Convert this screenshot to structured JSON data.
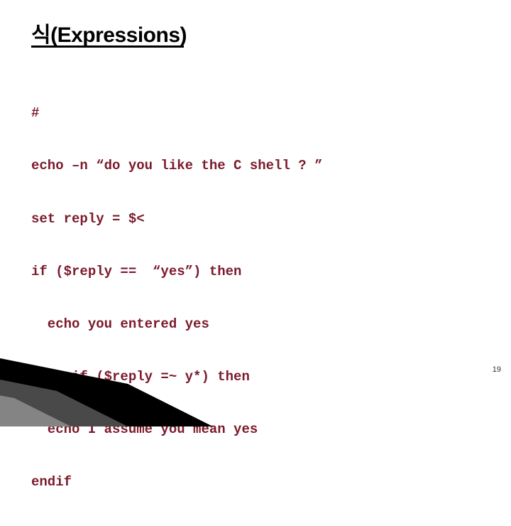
{
  "title": "식(Expressions)",
  "code_lines": [
    "#",
    "echo –n “do you like the C shell ? ”",
    "set reply = $<",
    "if ($reply ==  “yes”) then",
    "  echo you entered yes",
    "else if ($reply =~ y*) then",
    "  echo I assume you mean yes",
    "endif"
  ],
  "page_number": "19"
}
